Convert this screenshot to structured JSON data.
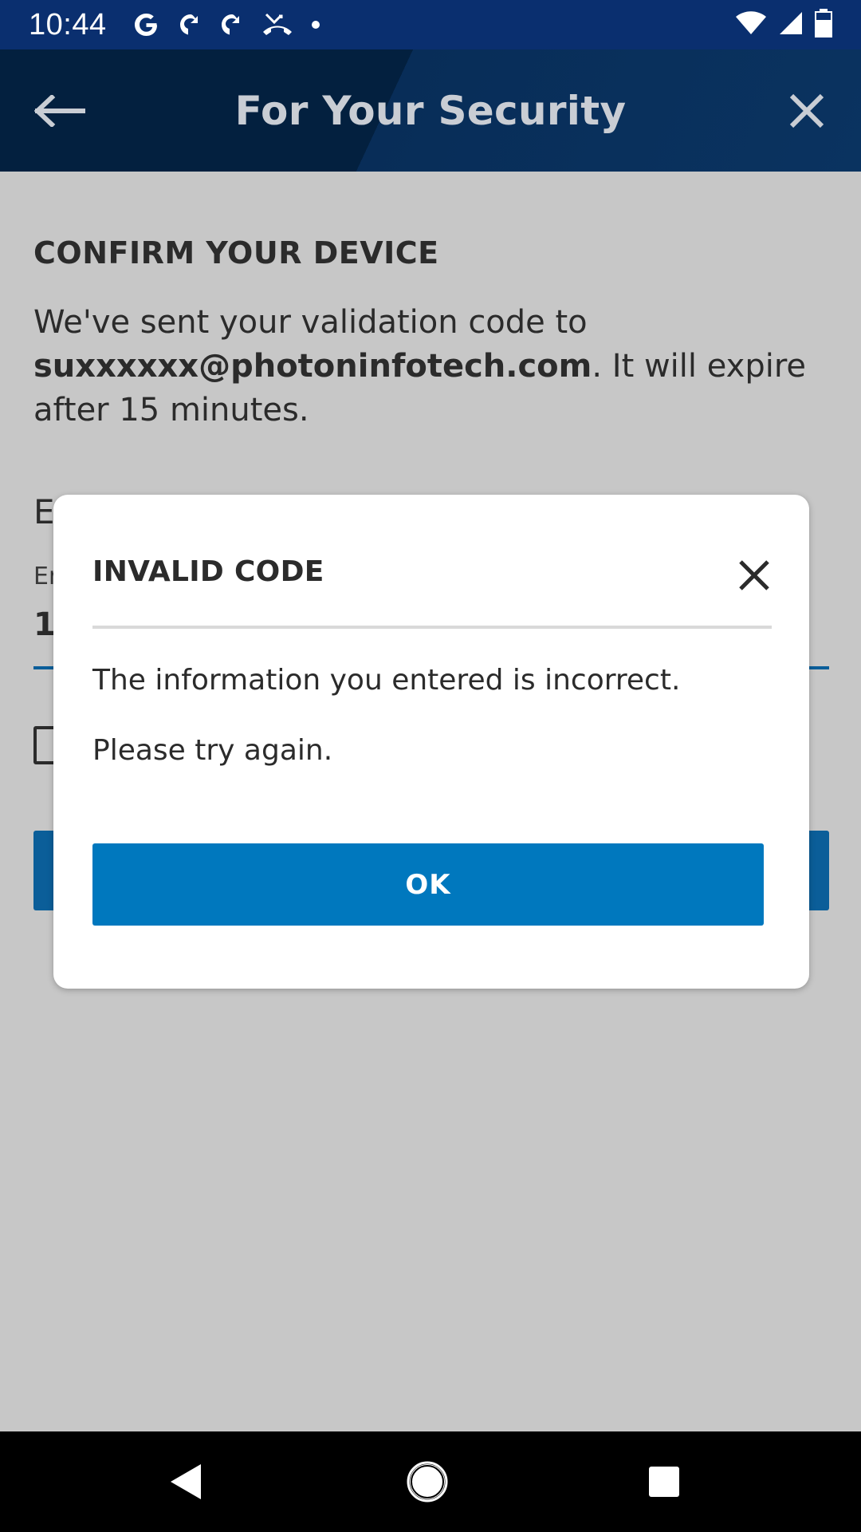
{
  "status_bar": {
    "time": "10:44",
    "icons": [
      "google-icon",
      "notification-icon",
      "notification-icon",
      "missed-call-icon",
      "dot-icon",
      "wifi-icon",
      "signal-icon",
      "battery-icon"
    ]
  },
  "header": {
    "title": "For Your Security",
    "back_icon": "arrow-left-icon",
    "close_icon": "close-icon",
    "colors": {
      "background": "#03203f",
      "title": "#c9cdd4"
    }
  },
  "page": {
    "heading": "CONFIRM YOUR DEVICE",
    "message_prefix": "We've sent your validation code to ",
    "email": "suxxxxxx@photoninfotech.com",
    "message_suffix": ". It will expire after 15 minutes.",
    "partial_heading": "E",
    "partial_label": "Er",
    "partial_value": "1",
    "colors": {
      "background": "#c7c7c7",
      "accent": "#0b5e99"
    }
  },
  "dialog": {
    "title": "INVALID CODE",
    "close_icon": "close-icon",
    "line1": "The information you entered is incorrect.",
    "line2": "Please try again.",
    "ok_label": "OK",
    "colors": {
      "button": "#0078be"
    }
  },
  "nav_bar": {
    "icons": [
      "back-triangle-icon",
      "home-circle-icon",
      "recents-square-icon"
    ]
  }
}
